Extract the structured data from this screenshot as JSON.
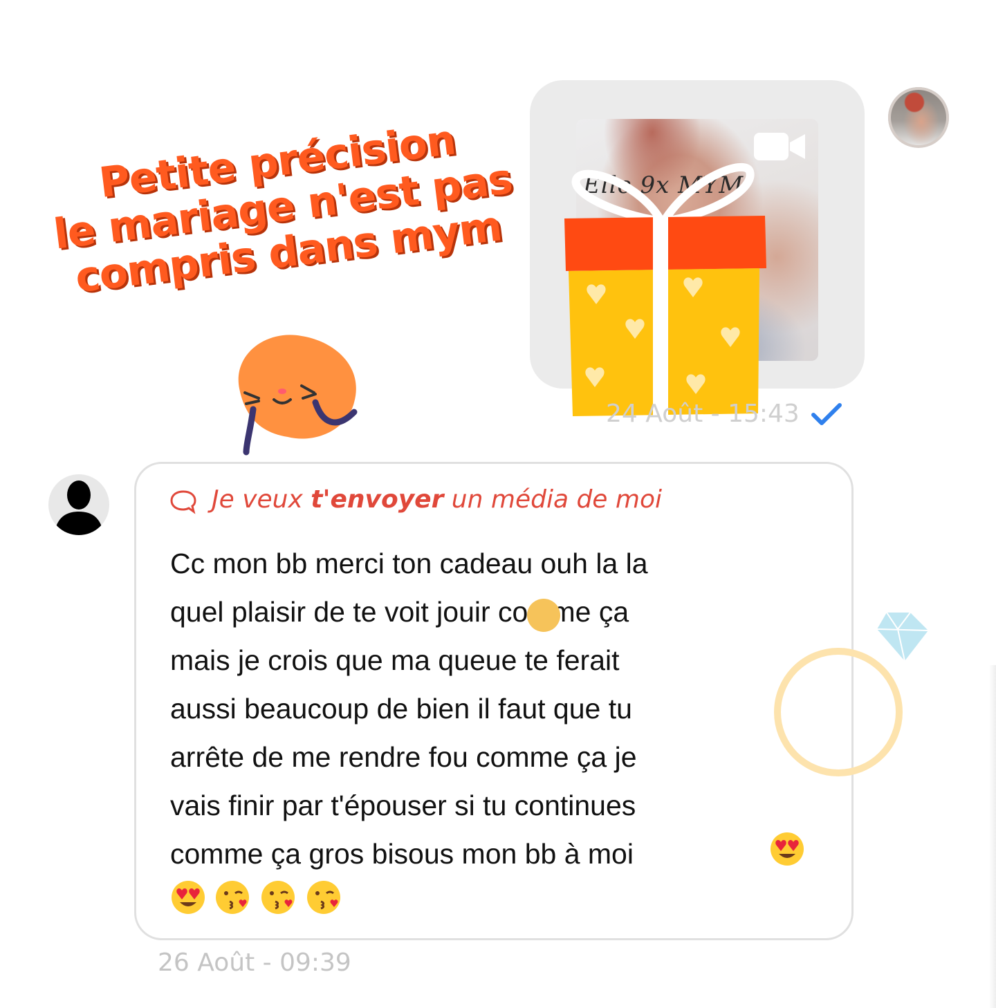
{
  "overlay": {
    "lines": [
      "Petite précision",
      "le mariage n'est pas",
      "compris dans mym"
    ],
    "color": "#ff5a1f"
  },
  "outgoing_message": {
    "media_type": "video",
    "media_watermark": "Elle 9x MYM",
    "timestamp": "24 Août - 15:43",
    "status": "sent",
    "icons": [
      "video-camera-icon",
      "check-icon",
      "gift-icon"
    ],
    "check_color": "#2f80ed"
  },
  "incoming_message": {
    "quote_prefix": "Je veux ",
    "quote_bold": "t'envoyer",
    "quote_suffix": " un média de moi",
    "quote_color": "#e0483a",
    "lines": [
      "Cc mon bb merci ton cadeau ouh la la",
      "quel plaisir de te voit jouir comme ça",
      "mais je crois que ma queue te ferait",
      "aussi beaucoup de bien il faut que tu",
      "arrête de me rendre fou comme ça je",
      "vais finir par t'épouser si tu continues",
      "comme ça gros bisous mon bb à moi"
    ],
    "emojis": [
      "heart-eyes-emoji",
      "heart-eyes-emoji",
      "kiss-emoji",
      "kiss-emoji",
      "kiss-emoji"
    ],
    "timestamp": "26 Août - 09:39"
  },
  "stickers": [
    "blushing-face-sticker",
    "gift-sticker",
    "diamond-ring-sticker",
    "yellow-dot-sticker"
  ]
}
